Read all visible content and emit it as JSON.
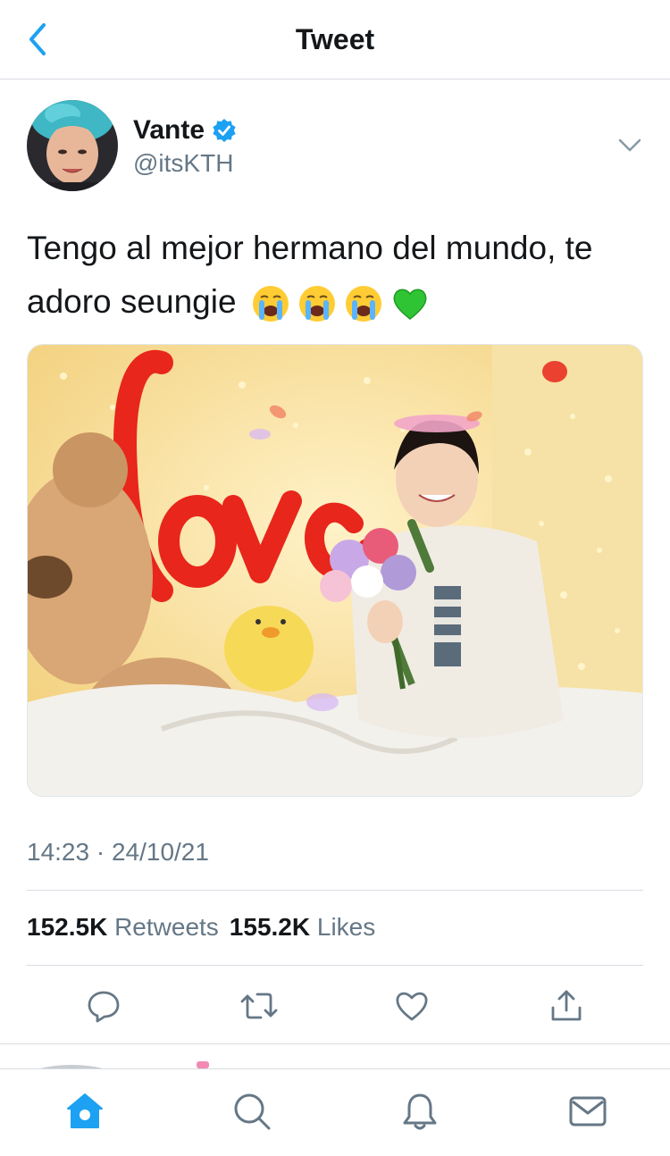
{
  "header": {
    "title": "Tweet"
  },
  "author": {
    "display_name": "Vante",
    "handle": "@itsKTH",
    "verified": true
  },
  "tweet": {
    "text": "Tengo al mejor hermano del mundo, te adoro seungie",
    "emojis": [
      "loudly-crying-face",
      "loudly-crying-face",
      "loudly-crying-face",
      "green-heart"
    ]
  },
  "meta": {
    "timestamp": "14:23 · 24/10/21"
  },
  "stats": {
    "retweets_count": "152.5K",
    "retweets_label": "Retweets",
    "likes_count": "155.2K",
    "likes_label": "Likes"
  },
  "colors": {
    "accent": "#1da1f2",
    "text": "#14171a",
    "secondary": "#657786",
    "divider": "#d8dde2"
  },
  "tabs": [
    "home-icon",
    "search-icon",
    "notifications-icon",
    "messages-icon"
  ]
}
